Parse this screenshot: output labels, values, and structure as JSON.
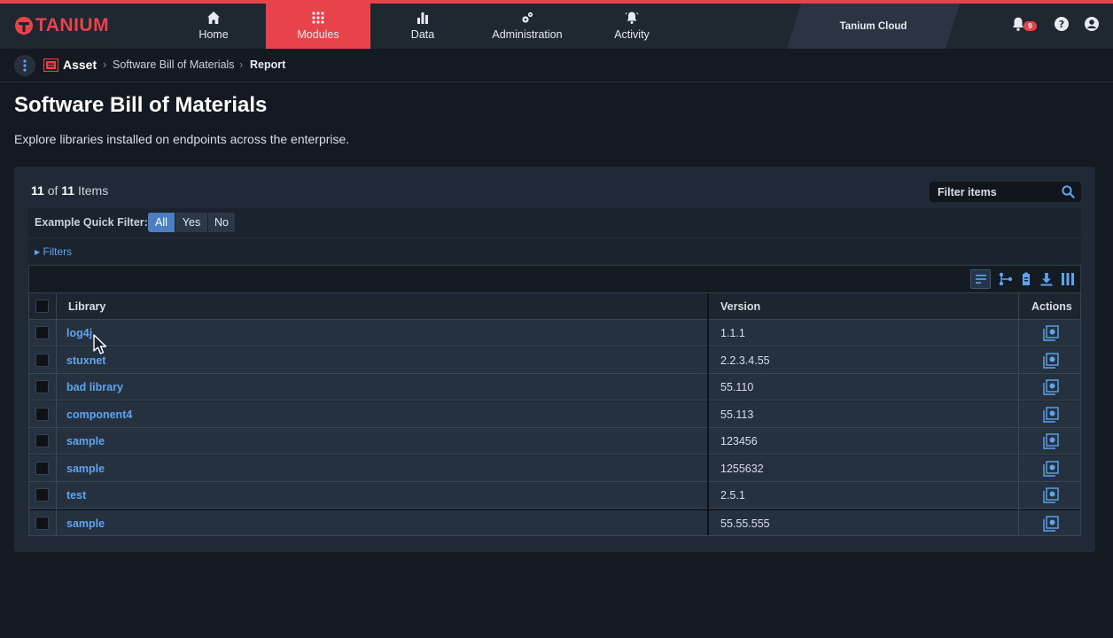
{
  "brand": {
    "name": "TANIUM",
    "accent": "#e8424b",
    "link_color": "#5ea4ef"
  },
  "nav": {
    "tabs": [
      {
        "label": "Home",
        "icon": "home-icon"
      },
      {
        "label": "Modules",
        "icon": "grid-icon",
        "active": true
      },
      {
        "label": "Data",
        "icon": "bar-chart-icon"
      },
      {
        "label": "Administration",
        "icon": "gears-icon"
      },
      {
        "label": "Activity",
        "icon": "bell-ring-icon"
      }
    ],
    "cloud_label": "Tanium Cloud",
    "notification_count": "9"
  },
  "breadcrumb": {
    "module": "Asset",
    "section": "Software Bill of Materials",
    "current": "Report"
  },
  "page": {
    "title": "Software Bill of Materials",
    "subtitle": "Explore libraries installed on endpoints across the enterprise."
  },
  "items": {
    "shown": "11",
    "of": "of",
    "total": "11",
    "label": "Items"
  },
  "search": {
    "placeholder": "Filter items"
  },
  "quick_filter": {
    "label": "Example Quick Filter:",
    "options": [
      "All",
      "Yes",
      "No"
    ],
    "selected": "All"
  },
  "filters_label": "Filters",
  "table": {
    "headers": {
      "library": "Library",
      "version": "Version",
      "actions": "Actions"
    },
    "rows": [
      {
        "library": "log4j",
        "version": "1.1.1"
      },
      {
        "library": "stuxnet",
        "version": "2.2.3.4.55"
      },
      {
        "library": "bad library",
        "version": "55.110"
      },
      {
        "library": "component4",
        "version": "55.113"
      },
      {
        "library": "sample",
        "version": "123456"
      },
      {
        "library": "sample",
        "version": "1255632"
      },
      {
        "library": "test",
        "version": "2.5.1"
      },
      {
        "library": "sample",
        "version": "55.55.555"
      }
    ]
  }
}
